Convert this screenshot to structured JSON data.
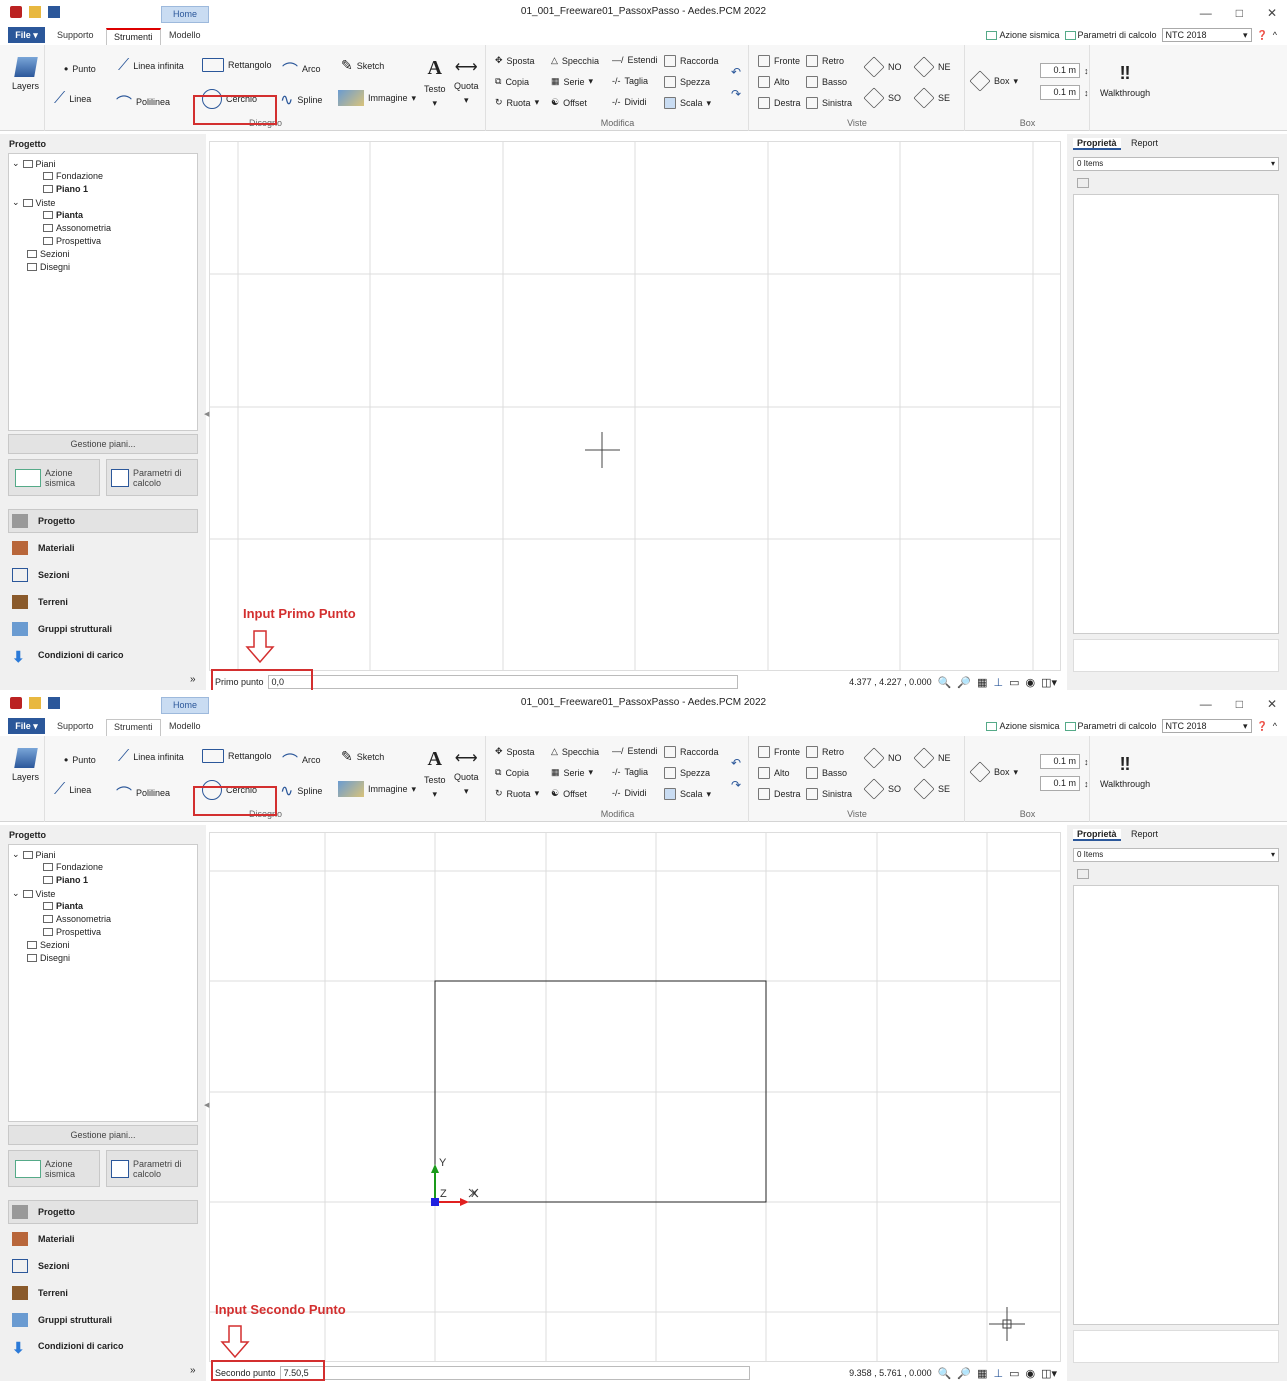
{
  "app": {
    "title": "01_001_Freeware01_PassoxPasso - Aedes.PCM 2022",
    "context_tab": "Home",
    "window_controls": [
      "—",
      "□",
      "✕"
    ]
  },
  "tabs": {
    "file": "File",
    "items": [
      "Supporto",
      "Strumenti",
      "Modello"
    ],
    "active": "Strumenti"
  },
  "top_right": {
    "seismic": "Azione sismica",
    "calc_params": "Parametri di calcolo",
    "norm": "NTC 2018"
  },
  "ribbon": {
    "layers": "Layers",
    "disegno": {
      "label": "Disegno",
      "items": [
        "Punto",
        "Linea infinita",
        "Rettangolo",
        "Arco",
        "Sketch",
        "Linea",
        "Polilinea",
        "Cerchio",
        "Spline",
        "Immagine",
        "Testo",
        "Quota"
      ]
    },
    "modifica": {
      "label": "Modifica",
      "items": [
        "Sposta",
        "Specchia",
        "Estendi",
        "Raccorda",
        "Copia",
        "Serie",
        "Taglia",
        "Spezza",
        "Ruota",
        "Offset",
        "Dividi",
        "Scala"
      ]
    },
    "viste": {
      "label": "Viste",
      "items": [
        "Fronte",
        "Retro",
        "Alto",
        "Basso",
        "Destra",
        "Sinistra",
        "NO",
        "NE",
        "SO",
        "SE"
      ]
    },
    "box": {
      "label": "Box",
      "button": "Box",
      "spin1": "0.1 m",
      "spin2": "0.1 m"
    },
    "walkthrough": "Walkthrough"
  },
  "left_panel": {
    "title": "Progetto",
    "tree": [
      "Piani",
      "Fondazione",
      "Piano 1",
      "Viste",
      "Pianta",
      "Assonometria",
      "Prospettiva",
      "Sezioni",
      "Disegni"
    ],
    "gestione": "Gestione piani...",
    "btn_seismic": "Azione sismica",
    "btn_params": "Parametri di calcolo",
    "nav": [
      "Progetto",
      "Materiali",
      "Sezioni",
      "Terreni",
      "Gruppi strutturali",
      "Condizioni di carico"
    ]
  },
  "right_panel": {
    "tabs": [
      "Proprietà",
      "Report"
    ],
    "selector": "0 Items"
  },
  "axes": {
    "y": "Y",
    "z": "Z",
    "x": "X"
  },
  "screen1": {
    "prompt_label": "Primo punto",
    "prompt_value": "0,0",
    "coords": "4.377 , 4.227 , 0.000",
    "annotation": "Input Primo Punto"
  },
  "screen2": {
    "prompt_label": "Secondo punto",
    "prompt_value": "7.50,5",
    "coords": "9.358 , 5.761 , 0.000",
    "annotation": "Input Secondo Punto"
  },
  "colors": {
    "accent": "#2b579a",
    "highlight": "#d32f2f"
  }
}
